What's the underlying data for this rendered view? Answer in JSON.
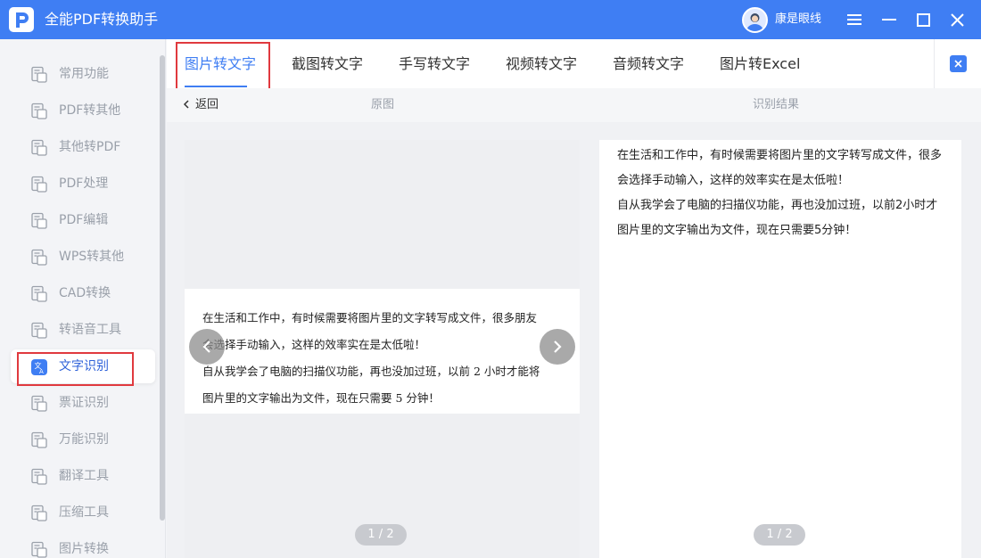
{
  "app": {
    "title": "全能PDF转换助手"
  },
  "user": {
    "name": "康是眼线"
  },
  "sidebar": {
    "items": [
      {
        "label": "常用功能",
        "icon": "grid-icon"
      },
      {
        "label": "PDF转其他",
        "icon": "pdf-export-icon"
      },
      {
        "label": "其他转PDF",
        "icon": "pdf-import-icon"
      },
      {
        "label": "PDF处理",
        "icon": "pdf-process-icon"
      },
      {
        "label": "PDF编辑",
        "icon": "pdf-edit-icon"
      },
      {
        "label": "WPS转其他",
        "icon": "wps-icon"
      },
      {
        "label": "CAD转换",
        "icon": "cad-icon"
      },
      {
        "label": "转语音工具",
        "icon": "text-to-speech-icon"
      },
      {
        "label": "文字识别",
        "icon": "ocr-icon"
      },
      {
        "label": "票证识别",
        "icon": "ticket-icon"
      },
      {
        "label": "万能识别",
        "icon": "universal-scan-icon"
      },
      {
        "label": "翻译工具",
        "icon": "translate-icon"
      },
      {
        "label": "压缩工具",
        "icon": "zip-icon"
      },
      {
        "label": "图片转换",
        "icon": "image-convert-icon"
      }
    ],
    "active_index": 8
  },
  "tabs": [
    {
      "label": "图片转文字"
    },
    {
      "label": "截图转文字"
    },
    {
      "label": "手写转文字"
    },
    {
      "label": "视频转文字"
    },
    {
      "label": "音频转文字"
    },
    {
      "label": "图片转Excel"
    }
  ],
  "subheader": {
    "back_label": "返回",
    "original_label": "原图",
    "result_label": "识别结果"
  },
  "original": {
    "lines": [
      "在生活和工作中，有时候需要将图片里的文字转写成文件，很多朋友",
      "会选择手动输入，这样的效率实在是太低啦！",
      "自从我学会了电脑的扫描仪功能，再也没加过班，以前 2 小时才能将",
      "图片里的文字输出为文件，现在只需要 5 分钟！"
    ],
    "page_indicator": "1 / 2"
  },
  "result": {
    "lines": [
      "在生活和工作中，有时候需要将图片里的文字转写成文件，很多",
      "会选择手动输入，这样的效率实在是太低啦！",
      "自从我学会了电脑的扫描仪功能，再也没加过班，以前2小时才",
      "图片里的文字输出为文件，现在只需要5分钟！"
    ],
    "page_indicator": "1 / 2"
  },
  "colors": {
    "primary": "#3f7ef3",
    "highlight": "#e0393e",
    "active_text": "#2f62d9"
  }
}
